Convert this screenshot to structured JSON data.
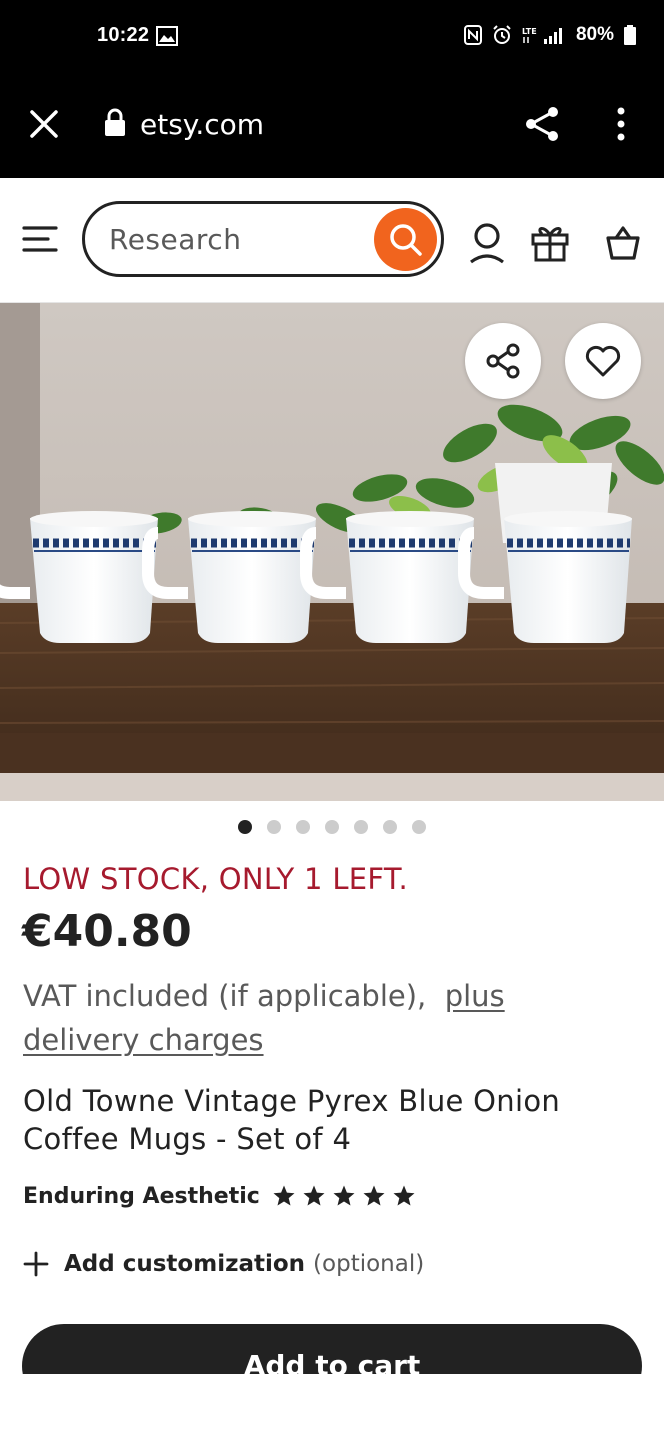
{
  "status_bar": {
    "time": "10:22",
    "battery": "80%",
    "icons": [
      "image-notification-icon",
      "nfc-icon",
      "alarm-icon",
      "lte-signal-icon",
      "battery-icon"
    ]
  },
  "browser": {
    "url": "etsy.com",
    "icons": [
      "close-icon",
      "lock-icon",
      "share-icon",
      "more-vert-icon"
    ]
  },
  "header": {
    "search_placeholder": "Research",
    "accent_color": "#f1641e",
    "icons": [
      "menu-icon",
      "search-icon",
      "account-icon",
      "gift-icon",
      "cart-icon"
    ]
  },
  "gallery": {
    "image_count": 7,
    "active_index": 0,
    "icons": [
      "share-icon",
      "heart-icon"
    ]
  },
  "product": {
    "stock_notice": "LOW STOCK, ONLY 1 LEFT.",
    "price": "€40.80",
    "vat_text": "VAT included (if applicable),",
    "delivery_link": "plus delivery charges",
    "title": "Old Towne Vintage Pyrex Blue Onion Coffee Mugs - Set of 4",
    "shop_name": "Enduring Aesthetic",
    "rating": 5,
    "rating_max": 5,
    "customization_label": "Add customization",
    "customization_note": "(optional)",
    "add_to_cart": "Add to cart",
    "stock_color": "#a61a2e"
  }
}
